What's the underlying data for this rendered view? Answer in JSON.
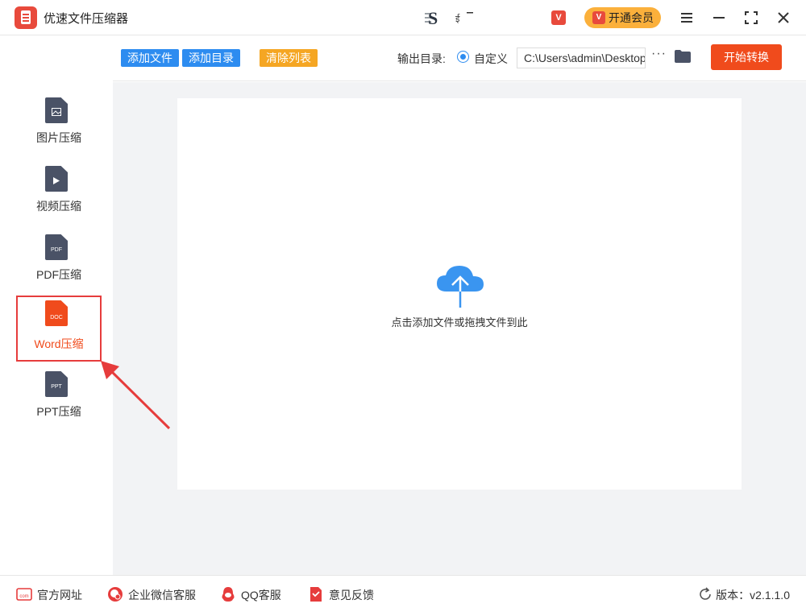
{
  "titlebar": {
    "app_title": "优速文件压缩器",
    "vip_small_icon": "V",
    "vip_button_label": "开通会员",
    "vip_button_icon": "V",
    "colors": {
      "brand": "#e84a3c",
      "vip": "#fbb03b"
    }
  },
  "sidebar": {
    "items": [
      {
        "label": "图片压缩",
        "icon": "image-file-icon",
        "tag": ""
      },
      {
        "label": "视频压缩",
        "icon": "video-file-icon",
        "tag": ""
      },
      {
        "label": "PDF压缩",
        "icon": "pdf-file-icon",
        "tag": "PDF"
      },
      {
        "label": "Word压缩",
        "icon": "doc-file-icon",
        "tag": "DOC",
        "active": true
      },
      {
        "label": "PPT压缩",
        "icon": "ppt-file-icon",
        "tag": "PPT"
      }
    ]
  },
  "toolbar": {
    "add_file_label": "添加文件",
    "add_dir_label": "添加目录",
    "clear_list_label": "清除列表",
    "output_label": "输出目录:",
    "custom_label": "自定义",
    "output_path": "C:\\Users\\admin\\Desktop",
    "more_label": "···",
    "start_label": "开始转换",
    "colors": {
      "primary": "#2d8cf0",
      "warning": "#f5a623",
      "danger": "#f04b1c"
    }
  },
  "main": {
    "drop_text": "点击添加文件或拖拽文件到此"
  },
  "footer": {
    "website_label": "官方网址",
    "wechat_label": "企业微信客服",
    "qq_label": "QQ客服",
    "feedback_label": "意见反馈",
    "version_label": "版本：v2.1.1.0",
    "website_icon_text": "com"
  }
}
